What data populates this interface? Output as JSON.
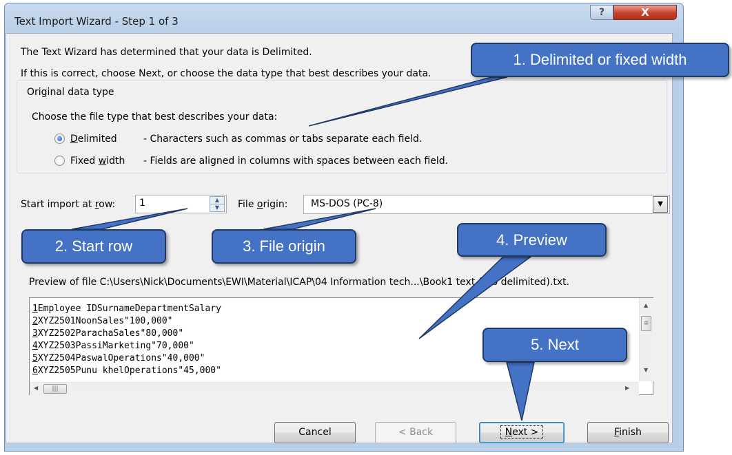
{
  "window": {
    "title": "Text Import Wizard - Step 1 of 3",
    "help_glyph": "?",
    "close_glyph": "X"
  },
  "intro": {
    "line1": "The Text Wizard has determined that your data is Delimited.",
    "line2": "If this is correct, choose Next, or choose the data type that best describes your data."
  },
  "data_type": {
    "group_label": "Original data type",
    "prompt": "Choose the file type that best describes your data:",
    "options": [
      {
        "label": "Delimited",
        "description": "- Characters such as commas or tabs separate each field.",
        "checked": true
      },
      {
        "label": "Fixed width",
        "description": "- Fields are aligned in columns with spaces between each field.",
        "checked": false
      }
    ]
  },
  "start_row": {
    "label": "Start import at row:",
    "value": "1"
  },
  "file_origin": {
    "label": "File origin:",
    "value": "MS-DOS (PC-8)"
  },
  "preview": {
    "caption": "Preview of file C:\\Users\\Nick\\Documents\\EWI\\Material\\ICAP\\04 Information tech...\\Book1 text (tab delimited).txt.",
    "lines": [
      {
        "num": "1",
        "text": "Employee IDSurnameDepartmentSalary"
      },
      {
        "num": "2",
        "text": "XYZ2501NoonSales\"100,000\""
      },
      {
        "num": "3",
        "text": "XYZ2502ParachaSales\"80,000\""
      },
      {
        "num": "4",
        "text": "XYZ2503PassiMarketing\"70,000\""
      },
      {
        "num": "5",
        "text": "XYZ2504PaswalOperations\"40,000\""
      },
      {
        "num": "6",
        "text": "XYZ2505Punu khelOperations\"45,000\""
      }
    ]
  },
  "buttons": {
    "cancel": "Cancel",
    "back": "< Back",
    "next": "Next >",
    "finish": "Finish"
  },
  "callouts": {
    "c1": "1. Delimited or fixed width",
    "c2": "2. Start row",
    "c3": "3. File origin",
    "c4": "4. Preview",
    "c5": "5. Next"
  },
  "colors": {
    "callout_fill": "#4472c4",
    "callout_border": "#203864",
    "title_bar": "#c9dbee",
    "dialog_bg": "#f0f0f0"
  }
}
